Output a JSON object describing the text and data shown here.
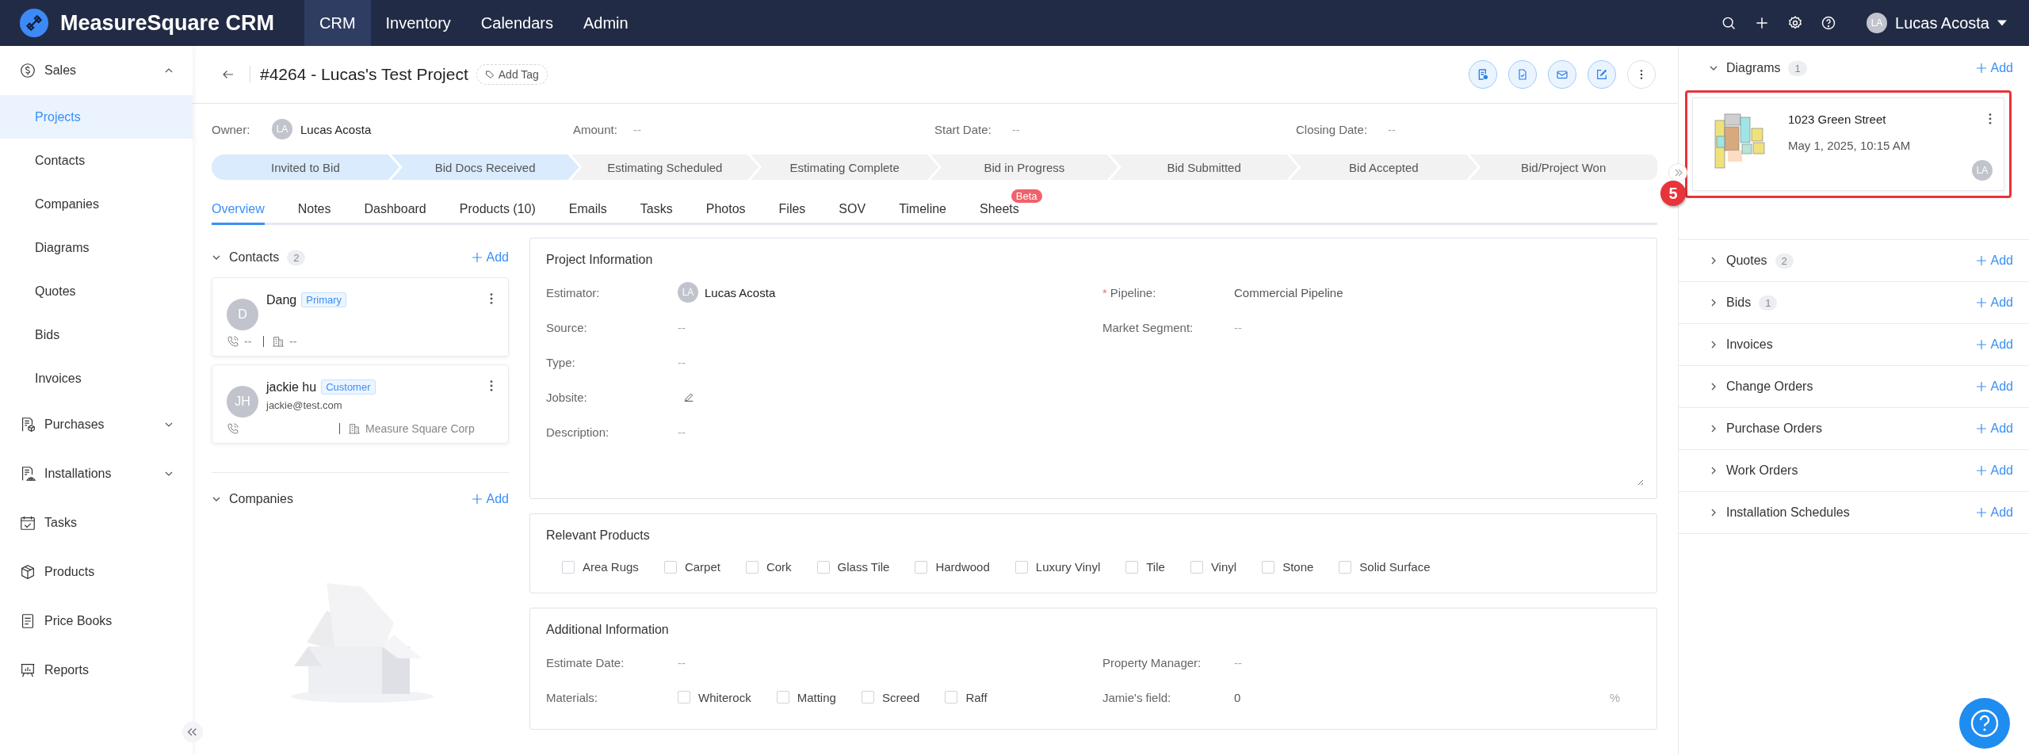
{
  "app": {
    "brand": "MeasureSquare CRM"
  },
  "top_nav": [
    {
      "label": "CRM",
      "selected": true
    },
    {
      "label": "Inventory",
      "selected": false
    },
    {
      "label": "Calendars",
      "selected": false
    },
    {
      "label": "Admin",
      "selected": false
    }
  ],
  "user": {
    "initials": "LA",
    "name": "Lucas Acosta"
  },
  "sidebar": {
    "items": [
      {
        "kind": "group",
        "label": "Sales",
        "expanded": true,
        "children": [
          {
            "label": "Projects",
            "selected": true
          },
          {
            "label": "Contacts",
            "selected": false
          },
          {
            "label": "Companies",
            "selected": false
          },
          {
            "label": "Diagrams",
            "selected": false
          },
          {
            "label": "Quotes",
            "selected": false
          },
          {
            "label": "Bids",
            "selected": false
          },
          {
            "label": "Invoices",
            "selected": false
          }
        ]
      },
      {
        "kind": "group",
        "label": "Purchases",
        "expanded": false
      },
      {
        "kind": "group",
        "label": "Installations",
        "expanded": false
      },
      {
        "kind": "link",
        "label": "Tasks"
      },
      {
        "kind": "link",
        "label": "Products"
      },
      {
        "kind": "link",
        "label": "Price Books"
      },
      {
        "kind": "link",
        "label": "Reports"
      }
    ]
  },
  "project": {
    "title": "#4264 - Lucas's Test Project",
    "add_tag": "Add Tag"
  },
  "summary": [
    {
      "label": "Owner:",
      "value": "Lucas Acosta",
      "avatar": "LA"
    },
    {
      "label": "Amount:",
      "value": "--"
    },
    {
      "label": "Start Date:",
      "value": "--"
    },
    {
      "label": "Closing Date:",
      "value": "--"
    }
  ],
  "stages": [
    {
      "label": "Invited to Bid",
      "reached": true
    },
    {
      "label": "Bid Docs Received",
      "reached": true
    },
    {
      "label": "Estimating Scheduled",
      "reached": false
    },
    {
      "label": "Estimating Complete",
      "reached": false
    },
    {
      "label": "Bid in Progress",
      "reached": false
    },
    {
      "label": "Bid Submitted",
      "reached": false
    },
    {
      "label": "Bid Accepted",
      "reached": false
    },
    {
      "label": "Bid/Project Won",
      "reached": false
    }
  ],
  "tabs": [
    {
      "label": "Overview",
      "selected": true
    },
    {
      "label": "Notes",
      "selected": false
    },
    {
      "label": "Dashboard",
      "selected": false
    },
    {
      "label": "Products (10)",
      "selected": false
    },
    {
      "label": "Emails",
      "selected": false
    },
    {
      "label": "Tasks",
      "selected": false
    },
    {
      "label": "Photos",
      "selected": false
    },
    {
      "label": "Files",
      "selected": false
    },
    {
      "label": "SOV",
      "selected": false
    },
    {
      "label": "Timeline",
      "selected": false
    },
    {
      "label": "Sheets",
      "selected": false,
      "badge": "Beta"
    }
  ],
  "contacts": {
    "title": "Contacts",
    "count": "2",
    "add": "Add",
    "expanded": true,
    "items": [
      {
        "initials": "D",
        "name": "Dang",
        "tag": "Primary",
        "phone": "--",
        "company": "--"
      },
      {
        "initials": "JH",
        "name": "jackie hu",
        "tag": "Customer",
        "email": "jackie@test.com",
        "company": "Measure Square Corp"
      }
    ]
  },
  "companies": {
    "title": "Companies",
    "add": "Add",
    "expanded": true
  },
  "project_info": {
    "title": "Project Information",
    "left": [
      {
        "kind": "person",
        "label": "Estimator:",
        "value": "Lucas Acosta",
        "avatar": "LA"
      },
      {
        "kind": "text",
        "label": "Source:",
        "value": "--"
      },
      {
        "kind": "text",
        "label": "Type:",
        "value": "--"
      },
      {
        "kind": "edit",
        "label": "Jobsite:"
      },
      {
        "kind": "text",
        "label": "Description:",
        "value": "--"
      }
    ],
    "right": [
      {
        "label": "Pipeline:",
        "required_mark": "*",
        "value": "Commercial Pipeline"
      },
      {
        "label": "Market Segment:",
        "value": "--"
      }
    ]
  },
  "relevant_products": {
    "title": "Relevant Products",
    "options": [
      {
        "label": "Area Rugs",
        "checked": false
      },
      {
        "label": "Carpet",
        "checked": false
      },
      {
        "label": "Cork",
        "checked": false
      },
      {
        "label": "Glass Tile",
        "checked": false
      },
      {
        "label": "Hardwood",
        "checked": false
      },
      {
        "label": "Luxury Vinyl",
        "checked": false
      },
      {
        "label": "Tile",
        "checked": false
      },
      {
        "label": "Vinyl",
        "checked": false
      },
      {
        "label": "Stone",
        "checked": false
      },
      {
        "label": "Solid Surface",
        "checked": false
      }
    ]
  },
  "additional_info": {
    "title": "Additional Information",
    "left": [
      {
        "kind": "text",
        "label": "Estimate Date:",
        "value": "--"
      },
      {
        "kind": "checks",
        "label": "Materials:",
        "options": [
          {
            "label": "Whiterock",
            "checked": false
          },
          {
            "label": "Matting",
            "checked": false
          },
          {
            "label": "Screed",
            "checked": false
          },
          {
            "label": "Raff",
            "checked": false
          }
        ]
      }
    ],
    "right": [
      {
        "label": "Property Manager:",
        "value": "--"
      },
      {
        "label": "Jamie's field:",
        "value": "0",
        "unit": "%"
      }
    ]
  },
  "right_panel": [
    {
      "title": "Diagrams",
      "count": "1",
      "add": "Add",
      "expanded": true,
      "items": [
        {
          "title": "1023 Green Street",
          "date": "May 1, 2025, 10:15 AM",
          "initials": "LA",
          "highlighted": true
        }
      ]
    },
    {
      "title": "Quotes",
      "count": "2",
      "add": "Add",
      "expanded": false
    },
    {
      "title": "Bids",
      "count": "1",
      "add": "Add",
      "expanded": false
    },
    {
      "title": "Invoices",
      "add": "Add",
      "expanded": false
    },
    {
      "title": "Change Orders",
      "add": "Add",
      "expanded": false
    },
    {
      "title": "Purchase Orders",
      "add": "Add",
      "expanded": false
    },
    {
      "title": "Work Orders",
      "add": "Add",
      "expanded": false
    },
    {
      "title": "Installation Schedules",
      "add": "Add",
      "expanded": false
    }
  ],
  "annotation": {
    "label": "5"
  }
}
